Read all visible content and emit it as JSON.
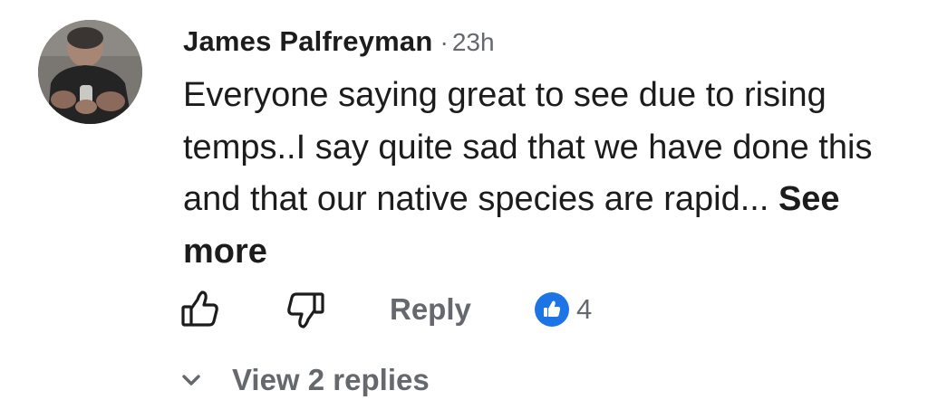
{
  "comment": {
    "author": "James Palfreyman",
    "separator": "·",
    "time": "23h",
    "text": "Everyone saying great to see due to rising temps..I say quite sad that we have done this and that our native species are rapid...",
    "see_more_label": "See more",
    "like_icon": "thumbs-up-outline-icon",
    "dislike_icon": "thumbs-down-outline-icon",
    "reply_label": "Reply",
    "reaction_icon": "like-reaction-icon",
    "reaction_count": "4",
    "view_replies_label": "View 2 replies",
    "accent_color": "#1d74e5"
  }
}
